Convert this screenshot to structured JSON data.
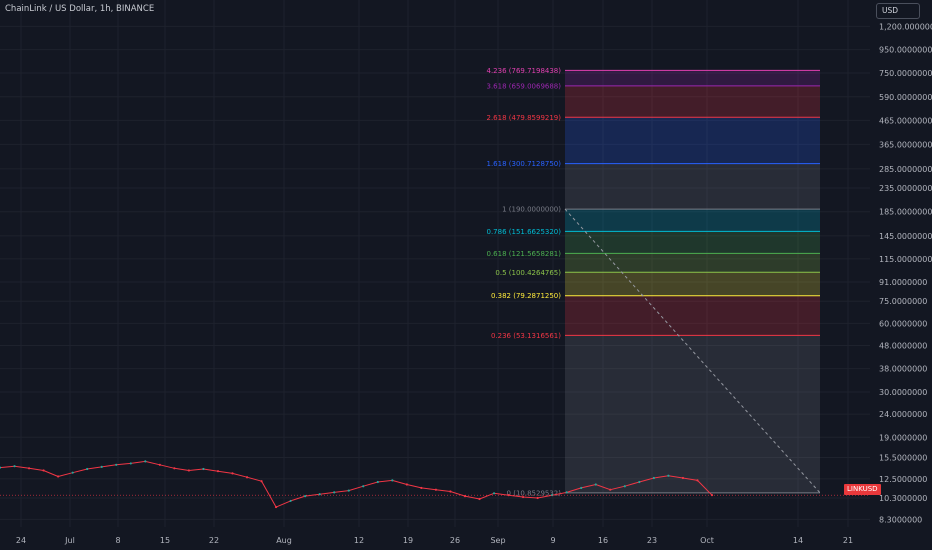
{
  "header": {
    "title": "ChainLink / US Dollar, 1h, BINANCE",
    "currency": "USD",
    "symbol_badge": "LINKUSD"
  },
  "chart_data": {
    "type": "line",
    "title": "ChainLink / US Dollar, 1h, BINANCE",
    "symbol": "LINKUSD",
    "interval": "1h",
    "exchange": "BINANCE",
    "y_scale": "log",
    "y_ticks": [
      "1,200.0000000",
      "950.0000000",
      "750.0000000",
      "590.0000000",
      "465.0000000",
      "365.0000000",
      "285.0000000",
      "235.0000000",
      "185.0000000",
      "145.0000000",
      "115.0000000",
      "91.0000000",
      "75.0000000",
      "60.0000000",
      "48.0000000",
      "38.0000000",
      "30.0000000",
      "24.0000000",
      "19.0000000",
      "15.5000000",
      "12.5000000",
      "10.3000000",
      "8.3000000"
    ],
    "x_ticks": [
      "24",
      "Jul",
      "8",
      "15",
      "22",
      "Aug",
      "12",
      "19",
      "26",
      "Sep",
      "9",
      "16",
      "23",
      "Oct",
      "14",
      "21"
    ],
    "grid": true,
    "series": [
      {
        "values": [
          14.0,
          14.2,
          13.9,
          13.6,
          12.8,
          13.3,
          13.8,
          14.1,
          14.4,
          14.6,
          14.9,
          14.4,
          13.9,
          13.6,
          13.8,
          13.5,
          13.2,
          12.7,
          12.2,
          9.4,
          10.0,
          10.5,
          10.7,
          10.9,
          11.1,
          11.6,
          12.1,
          12.3,
          11.8,
          11.4,
          11.2,
          11.0,
          10.5,
          10.2,
          10.8,
          10.6,
          10.4,
          10.3,
          10.6,
          10.9,
          11.4,
          11.8,
          11.2,
          11.6,
          12.1,
          12.6,
          12.9,
          12.6,
          12.3,
          10.6
        ]
      }
    ],
    "fib_retracement": {
      "start_price": 190.0,
      "end_price": 10.8529532,
      "levels": [
        {
          "ratio": "4.236",
          "price": "769.7198438",
          "label": "4.236 (769.7198438)",
          "color": "#e040b0"
        },
        {
          "ratio": "3.618",
          "price": "659.0069688",
          "label": "3.618 (659.0069688)",
          "color": "#9c27b0"
        },
        {
          "ratio": "2.618",
          "price": "479.8599219",
          "label": "2.618 (479.8599219)",
          "color": "#f23645"
        },
        {
          "ratio": "1.618",
          "price": "300.7128750",
          "label": "1.618 (300.7128750)",
          "color": "#2962ff"
        },
        {
          "ratio": "1",
          "price": "190.0000000",
          "label": "1 (190.0000000)",
          "color": "#787b86"
        },
        {
          "ratio": "0.786",
          "price": "151.6625320",
          "label": "0.786 (151.6625320)",
          "color": "#00bcd4"
        },
        {
          "ratio": "0.618",
          "price": "121.5658281",
          "label": "0.618 (121.5658281)",
          "color": "#4caf50"
        },
        {
          "ratio": "0.5",
          "price": "100.4264765",
          "label": "0.5 (100.4264765)",
          "color": "#8bc34a"
        },
        {
          "ratio": "0.382",
          "price": "79.2871250",
          "label": "0.382 (79.2871250)",
          "color": "#ffeb3b"
        },
        {
          "ratio": "0.236",
          "price": "53.1316561",
          "label": "0.236 (53.1316561)",
          "color": "#f23645"
        },
        {
          "ratio": "0",
          "price": "10.8529532",
          "label": "0 (10.8529532)",
          "color": "#787b86"
        }
      ]
    }
  }
}
